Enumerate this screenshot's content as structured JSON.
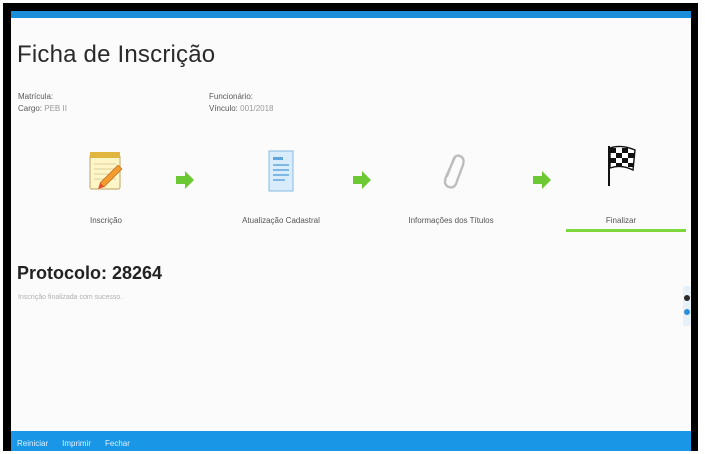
{
  "page": {
    "title": "Ficha de Inscrição"
  },
  "info": {
    "matricula_label": "Matrícula:",
    "matricula_value": "",
    "cargo_label": "Cargo:",
    "cargo_value": "PEB II",
    "funcionario_label": "Funcionário:",
    "funcionario_value": "",
    "vinculo_label": "Vínculo:",
    "vinculo_value": "001/2018"
  },
  "steps": [
    {
      "label": "Inscrição",
      "icon": "notepad-pencil-icon"
    },
    {
      "label": "Atualização Cadastral",
      "icon": "document-icon"
    },
    {
      "label": "Informações dos Títulos",
      "icon": "paperclip-icon"
    },
    {
      "label": "Finalizar",
      "icon": "checkered-flag-icon",
      "active": true
    }
  ],
  "protocolo": {
    "label": "Protocolo:",
    "number": "28264",
    "message": "Inscrição finalizada com sucesso."
  },
  "footer": {
    "reiniciar": "Reiniciar",
    "imprimir": "Imprimir",
    "fechar": "Fechar"
  },
  "colors": {
    "accent_blue": "#1996e6",
    "step_active_green": "#7dd63a",
    "arrow_green": "#6cc934"
  }
}
